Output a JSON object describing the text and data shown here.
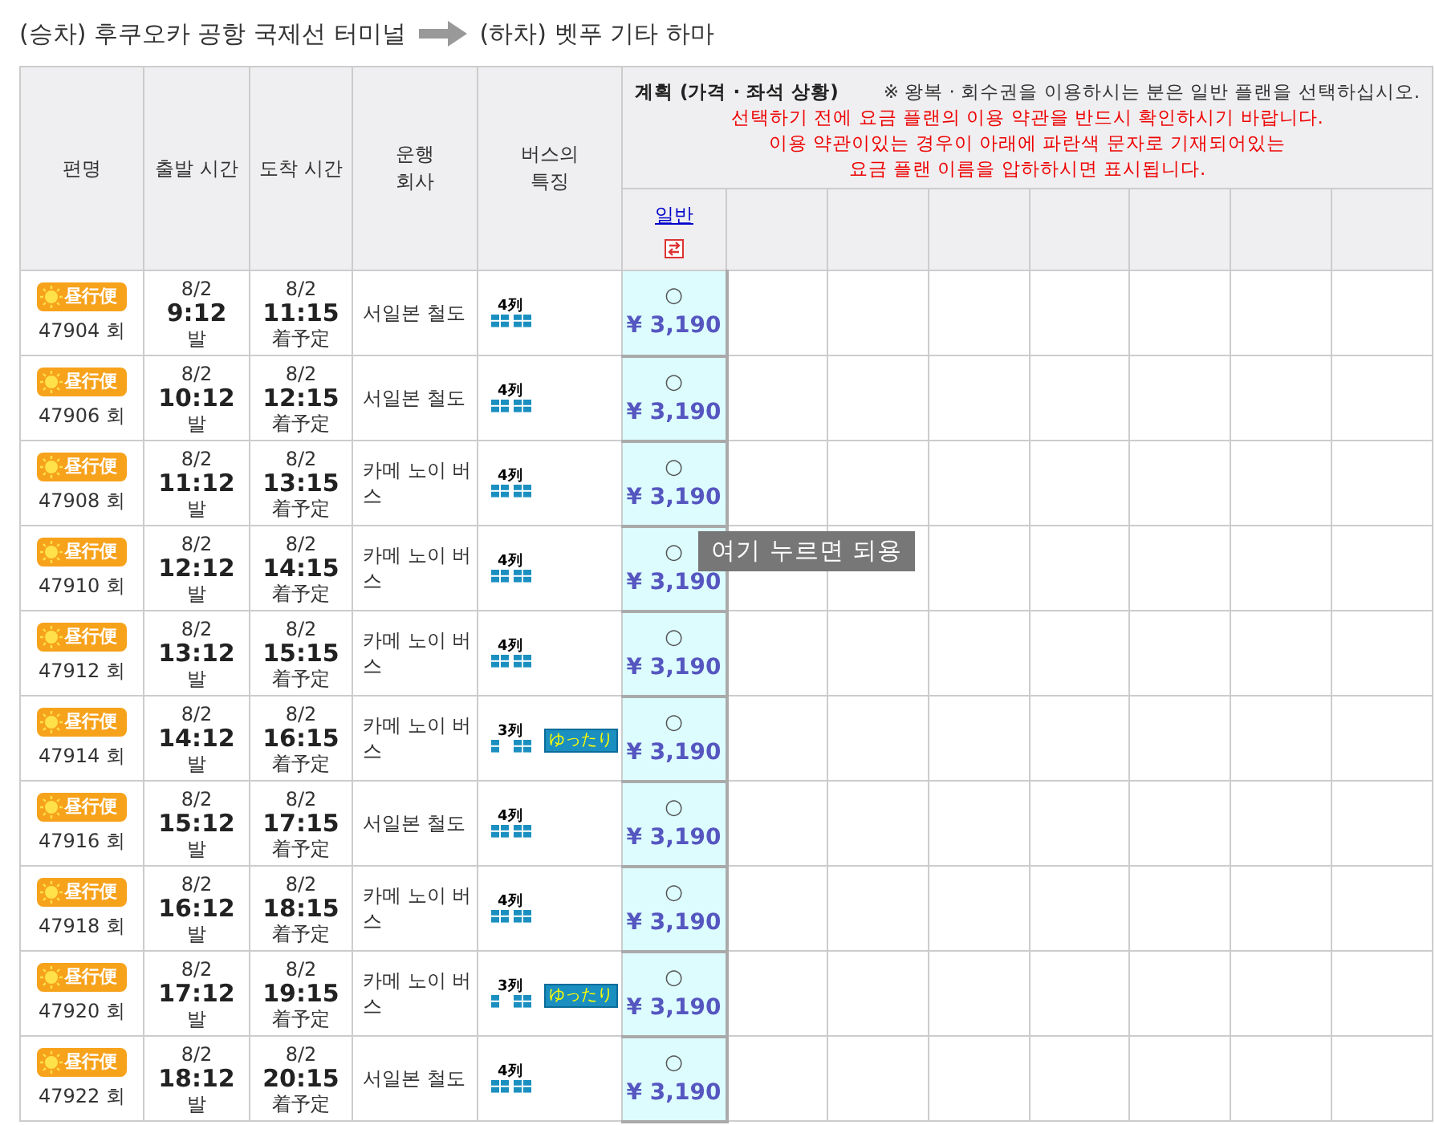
{
  "route": {
    "boarding": "(승차) 후쿠오카 공항 국제선 터미널",
    "alighting": "(하차) 벳푸 기타 하마"
  },
  "table": {
    "columns": [
      {
        "lines": [
          "편명"
        ]
      },
      {
        "lines": [
          "출발 시간"
        ]
      },
      {
        "lines": [
          "도착 시간"
        ]
      },
      {
        "lines": [
          "운행",
          "회사"
        ]
      },
      {
        "lines": [
          "버스의",
          "특징"
        ]
      }
    ],
    "plan_header": {
      "title": "계획 (가격 · 좌석 상황)",
      "note": "※ 왕복 · 회수권을 이용하시는 분은 일반 플랜을 선택하십시오.",
      "warning": [
        "선택하기 전에 요금 플랜의 이용 약관을 반드시 확인하시기 바랍니다.",
        "이용 약관이있는 경우이 아래에 파란색 문자로 기재되어있는",
        "요금 플랜 이름을 압하하시면 표시됩니다."
      ]
    },
    "plans": [
      {
        "label": "일반"
      }
    ],
    "rows": [
      {
        "service": "昼行便",
        "number": "47904 회",
        "dep_date": "8/2",
        "dep_time": "9:12",
        "dep_label": "발",
        "arr_date": "8/2",
        "arr_time": "11:15",
        "arr_label": "着予定",
        "company": "서일본 철도",
        "kind": "standard",
        "seats": "4列",
        "availability": "○",
        "price": "¥ 3,190"
      },
      {
        "service": "昼行便",
        "number": "47906 회",
        "dep_date": "8/2",
        "dep_time": "10:12",
        "dep_label": "발",
        "arr_date": "8/2",
        "arr_time": "12:15",
        "arr_label": "着予定",
        "company": "서일본 철도",
        "kind": "standard",
        "seats": "4列",
        "availability": "○",
        "price": "¥ 3,190"
      },
      {
        "service": "昼行便",
        "number": "47908 회",
        "dep_date": "8/2",
        "dep_time": "11:12",
        "dep_label": "발",
        "arr_date": "8/2",
        "arr_time": "13:15",
        "arr_label": "着予定",
        "company": "카메 노이 버스",
        "kind": "standard",
        "seats": "4列",
        "availability": "○",
        "price": "¥ 3,190"
      },
      {
        "service": "昼行便",
        "number": "47910 회",
        "dep_date": "8/2",
        "dep_time": "12:12",
        "dep_label": "발",
        "arr_date": "8/2",
        "arr_time": "14:15",
        "arr_label": "着予定",
        "company": "카메 노이 버스",
        "kind": "standard",
        "seats": "4列",
        "availability": "○",
        "price": "¥ 3,190"
      },
      {
        "service": "昼行便",
        "number": "47912 회",
        "dep_date": "8/2",
        "dep_time": "13:12",
        "dep_label": "발",
        "arr_date": "8/2",
        "arr_time": "15:15",
        "arr_label": "着予定",
        "company": "카메 노이 버스",
        "kind": "standard",
        "seats": "4列",
        "availability": "○",
        "price": "¥ 3,190"
      },
      {
        "service": "昼行便",
        "number": "47914 회",
        "dep_date": "8/2",
        "dep_time": "14:12",
        "dep_label": "발",
        "arr_date": "8/2",
        "arr_time": "16:15",
        "arr_label": "着予定",
        "company": "카메 노이 버스",
        "kind": "relaxed",
        "seats": "3列",
        "relaxed_label": "ゆったり",
        "availability": "○",
        "price": "¥ 3,190"
      },
      {
        "service": "昼行便",
        "number": "47916 회",
        "dep_date": "8/2",
        "dep_time": "15:12",
        "dep_label": "발",
        "arr_date": "8/2",
        "arr_time": "17:15",
        "arr_label": "着予定",
        "company": "서일본 철도",
        "kind": "standard",
        "seats": "4列",
        "availability": "○",
        "price": "¥ 3,190"
      },
      {
        "service": "昼行便",
        "number": "47918 회",
        "dep_date": "8/2",
        "dep_time": "16:12",
        "dep_label": "발",
        "arr_date": "8/2",
        "arr_time": "18:15",
        "arr_label": "着予定",
        "company": "카메 노이 버스",
        "kind": "standard",
        "seats": "4列",
        "availability": "○",
        "price": "¥ 3,190"
      },
      {
        "service": "昼行便",
        "number": "47920 회",
        "dep_date": "8/2",
        "dep_time": "17:12",
        "dep_label": "발",
        "arr_date": "8/2",
        "arr_time": "19:15",
        "arr_label": "着予定",
        "company": "카메 노이 버스",
        "kind": "relaxed",
        "seats": "3列",
        "relaxed_label": "ゆったり",
        "availability": "○",
        "price": "¥ 3,190"
      },
      {
        "service": "昼行便",
        "number": "47922 회",
        "dep_date": "8/2",
        "dep_time": "18:12",
        "dep_label": "발",
        "arr_date": "8/2",
        "arr_time": "20:15",
        "arr_label": "着予定",
        "company": "서일본 철도",
        "kind": "standard",
        "seats": "4列",
        "availability": "○",
        "price": "¥ 3,190"
      }
    ]
  },
  "tooltip": "여기 누르면 되용"
}
